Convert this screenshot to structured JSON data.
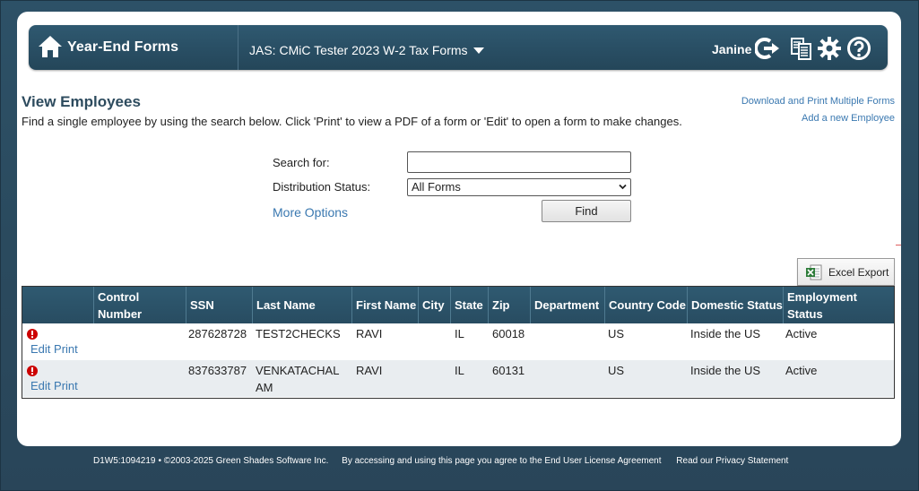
{
  "header": {
    "brand": "Year-End Forms",
    "form_selector": "JAS: CMiC Tester 2023 W-2 Tax Forms",
    "user": "Janine"
  },
  "page": {
    "title": "View Employees",
    "instructions": "Find a single employee by using the search below. Click 'Print' to view a PDF of a form or 'Edit' to open a form to make changes.",
    "link_download": "Download and Print Multiple Forms",
    "link_add": "Add a new Employee"
  },
  "search": {
    "label": "Search for:",
    "value": "",
    "status_label": "Distribution Status:",
    "status_value": "All Forms",
    "more_options": "More Options",
    "find_label": "Find"
  },
  "excel_export": "Excel Export",
  "table": {
    "columns": [
      "",
      "Control Number",
      "SSN",
      "Last Name",
      "First Name",
      "City",
      "State",
      "Zip",
      "Department",
      "Country Code",
      "Domestic Status",
      "Employment Status"
    ],
    "rows": [
      {
        "control": "",
        "ssn": "287628728",
        "last": "TEST2CHECKS",
        "first": "RAVI",
        "city": "",
        "state": "IL",
        "zip": "60018",
        "dept": "",
        "country": "US",
        "domestic": "Inside the US",
        "employment": "Active",
        "edit": "Edit",
        "print": "Print"
      },
      {
        "control": "",
        "ssn": "837633787",
        "last": "VENKATACHAL AM",
        "first": "RAVI",
        "city": "",
        "state": "IL",
        "zip": "60131",
        "dept": "",
        "country": "US",
        "domestic": "Inside the US",
        "employment": "Active",
        "edit": "Edit",
        "print": "Print"
      }
    ]
  },
  "footer": {
    "build": "D1W5:1094219",
    "copyright": "• ©2003-2025 Green Shades Software Inc.",
    "agreement": "By accessing and using this page you agree to the End User License Agreement",
    "privacy": "Read our Privacy Statement"
  },
  "colors": {
    "header_bg": "#2a5066",
    "link": "#3a78b0",
    "alert": "#cc0000"
  }
}
